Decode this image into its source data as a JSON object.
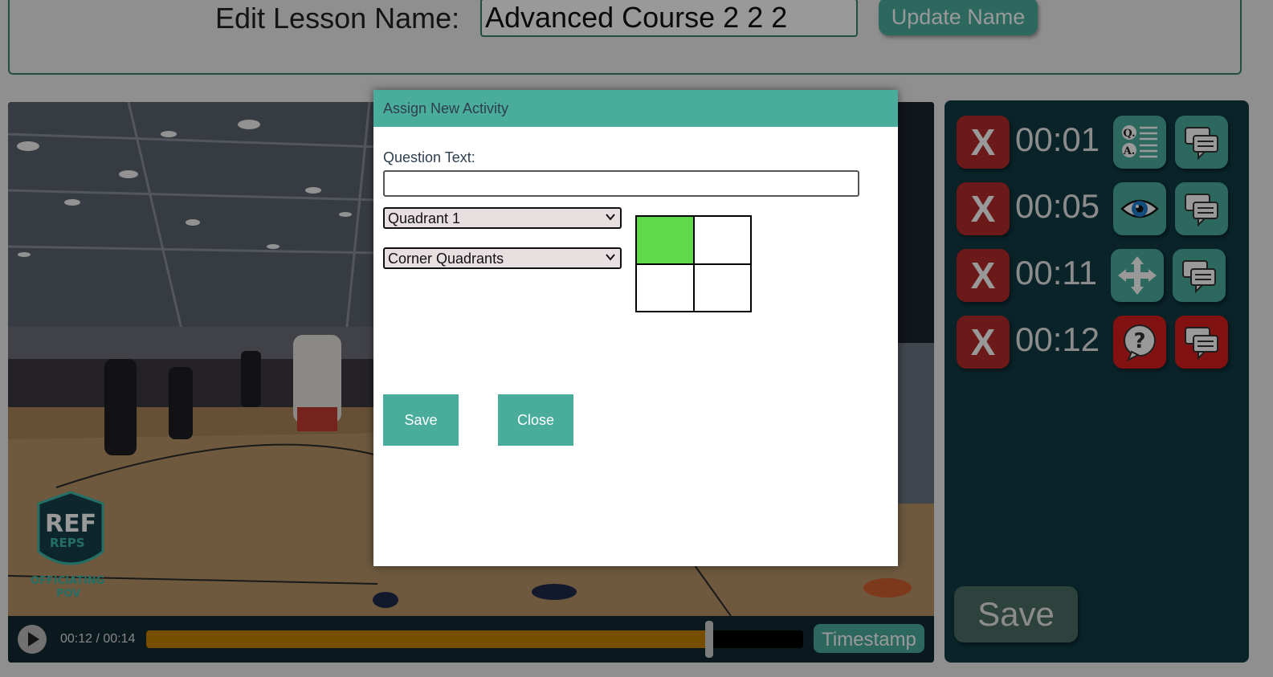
{
  "header": {
    "label": "Edit Lesson Name:",
    "lesson_name": "Advanced Course 2 2 2",
    "update_button": "Update Name"
  },
  "video": {
    "watermark_lines": [
      "REF",
      "REPS",
      "OFFICIATING",
      "POV"
    ],
    "time_readout": "00:12 / 00:14",
    "progress_fraction": 0.857,
    "timestamp_button": "Timestamp"
  },
  "timeline": {
    "entries": [
      {
        "delete_label": "X",
        "time": "00:01",
        "activity_icon": "qa-list-icon",
        "activity_color": "#4aad9b",
        "comment_color": "#4aad9b"
      },
      {
        "delete_label": "X",
        "time": "00:05",
        "activity_icon": "eye-icon",
        "activity_color": "#4aad9b",
        "comment_color": "#4aad9b"
      },
      {
        "delete_label": "X",
        "time": "00:11",
        "activity_icon": "move-arrows-icon",
        "activity_color": "#4aad9b",
        "comment_color": "#4aad9b"
      },
      {
        "delete_label": "X",
        "time": "00:12",
        "activity_icon": "question-bubble-icon",
        "activity_color": "#d91e1e",
        "comment_color": "#d91e1e"
      }
    ],
    "save_button": "Save"
  },
  "modal": {
    "title": "Assign New Activity",
    "question_label": "Question Text:",
    "question_value": "",
    "quadrant_select": "Quadrant 1",
    "layout_select": "Corner Quadrants",
    "quadrants": [
      {
        "name": "Quadrant 1",
        "selected": true
      },
      {
        "name": "Quadrant 2",
        "selected": false
      },
      {
        "name": "Quadrant 3",
        "selected": false
      },
      {
        "name": "Quadrant 4",
        "selected": false
      }
    ],
    "save_button": "Save",
    "close_button": "Close"
  },
  "colors": {
    "accent": "#4aad9b",
    "danger": "#b32a2a",
    "active_red": "#d91e1e",
    "progress": "#c68300",
    "quadrant_selected": "#5fd84a"
  }
}
